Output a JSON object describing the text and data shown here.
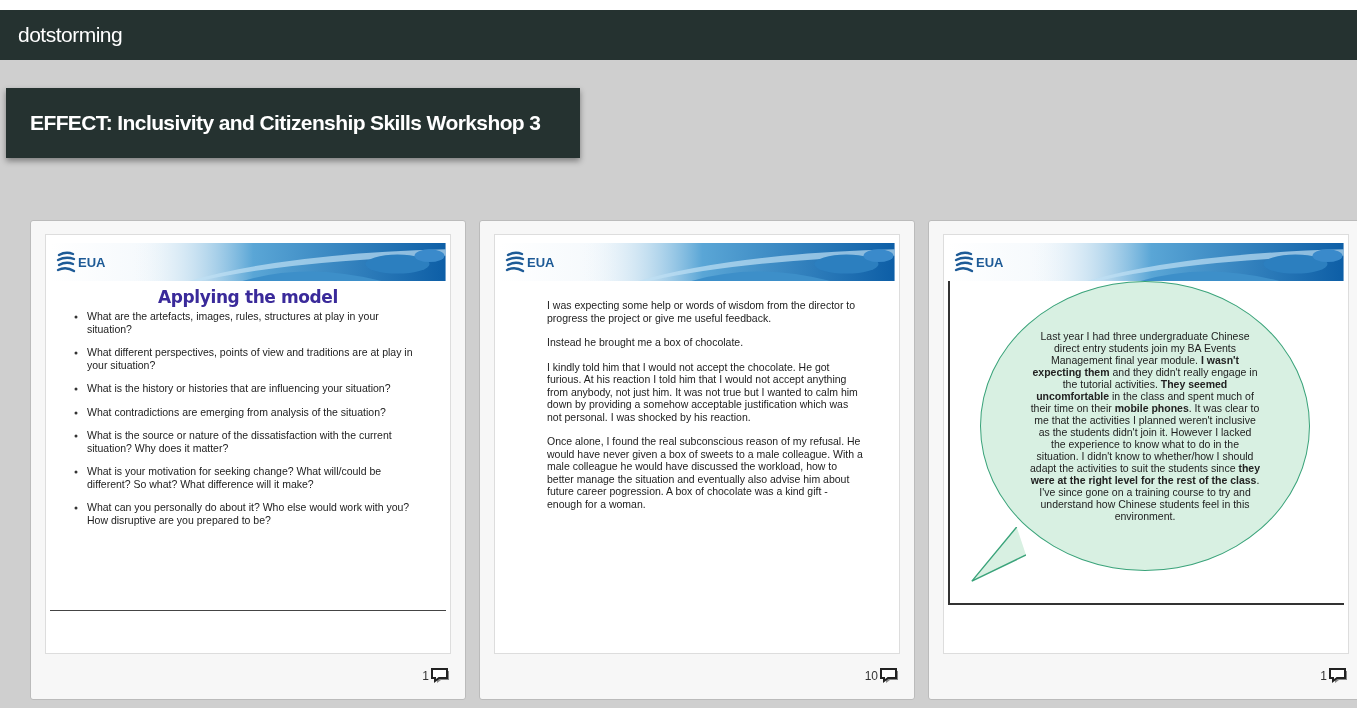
{
  "app": {
    "name": "dotstorming"
  },
  "board": {
    "title": "EFFECT: Inclusivity and Citizenship Skills Workshop 3"
  },
  "cards": [
    {
      "kind": "bullets",
      "banner": "EUA",
      "heading": "Applying the model",
      "items": [
        "What are the artefacts, images, rules, structures at play in your situation?",
        "What different perspectives, points of view and traditions are at play in your situation?",
        "What is the history or histories that are influencing your situation?",
        "What contradictions are emerging from analysis of the situation?",
        "What is the source or nature of the dissatisfaction with the current situation? Why does it matter?",
        "What is your motivation for seeking change? What will/could be different? So what? What difference will it make?",
        "What can you personally do about it? Who else would work with you? How disruptive are you prepared to be?"
      ],
      "comment_count": "1"
    },
    {
      "kind": "text",
      "banner": "EUA",
      "paragraphs": [
        "I was expecting some help or words of wisdom from the director to progress the project or give me useful feedback.",
        "Instead he brought me a box of chocolate.",
        "I kindly told him that I would not accept the chocolate. He got furious. At his reaction I told him that I would not accept anything from anybody, not just him. It was not true but I wanted to calm him down by providing a somehow acceptable justification which was not personal. I was shocked by his reaction.",
        "Once alone, I found the real subconscious reason of my refusal. He would have never given a box of sweets to a male colleague. With a male colleague he would have discussed the workload, how to better manage the situation and eventually also advise him about future career pogression. A box of chocolate was a kind gift - enough for a woman."
      ],
      "comment_count": "10"
    },
    {
      "kind": "bubble",
      "banner": "EUA",
      "bubble_text": "Last year I had three undergraduate Chinese direct entry students join my BA Events Management final year module. **I wasn't expecting them** and they didn't really engage in the tutorial activities. **They seemed uncomfortable** in the class and spent much of their time on their **mobile phones**. It was clear to me that the activities I planned weren't inclusive as the students didn't join it. However I lacked the experience to know what to do in the situation. I didn't know to whether/how I should adapt the activities to suit the students since **they were at the right level for the rest of the class**. I've since gone on a training course to try and understand how Chinese students feel in this environment.",
      "comment_count": "1"
    }
  ]
}
